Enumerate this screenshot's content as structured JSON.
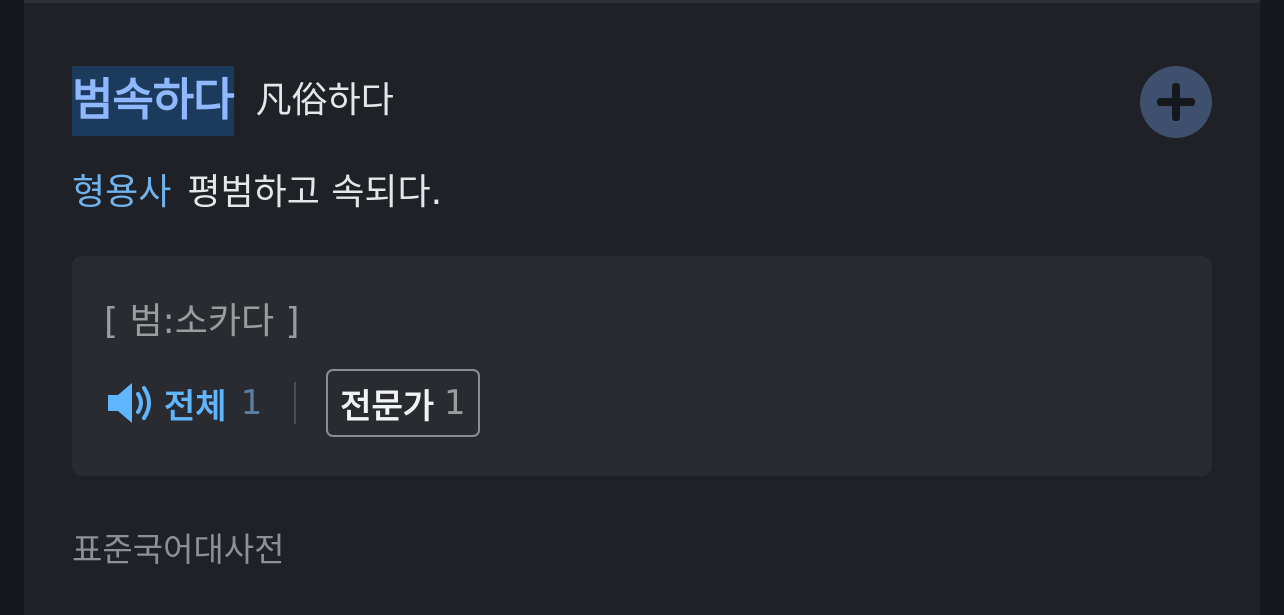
{
  "entry": {
    "headword": "범속하다",
    "hanja": "凡俗하다",
    "part_of_speech": "형용사",
    "definition": "평범하고 속되다.",
    "add_icon": "plus-icon"
  },
  "pronunciation": {
    "text": "[ 범:소카다 ]",
    "speaker_icon": "speaker-icon",
    "all_label": "전체",
    "all_count": "1",
    "expert_label": "전문가",
    "expert_count": "1"
  },
  "source": "표준국어대사전",
  "colors": {
    "headword": "#8fb8ff",
    "headword_highlight": "#1b3a5c",
    "accent": "#5fb6ff",
    "background": "#1f2126"
  }
}
